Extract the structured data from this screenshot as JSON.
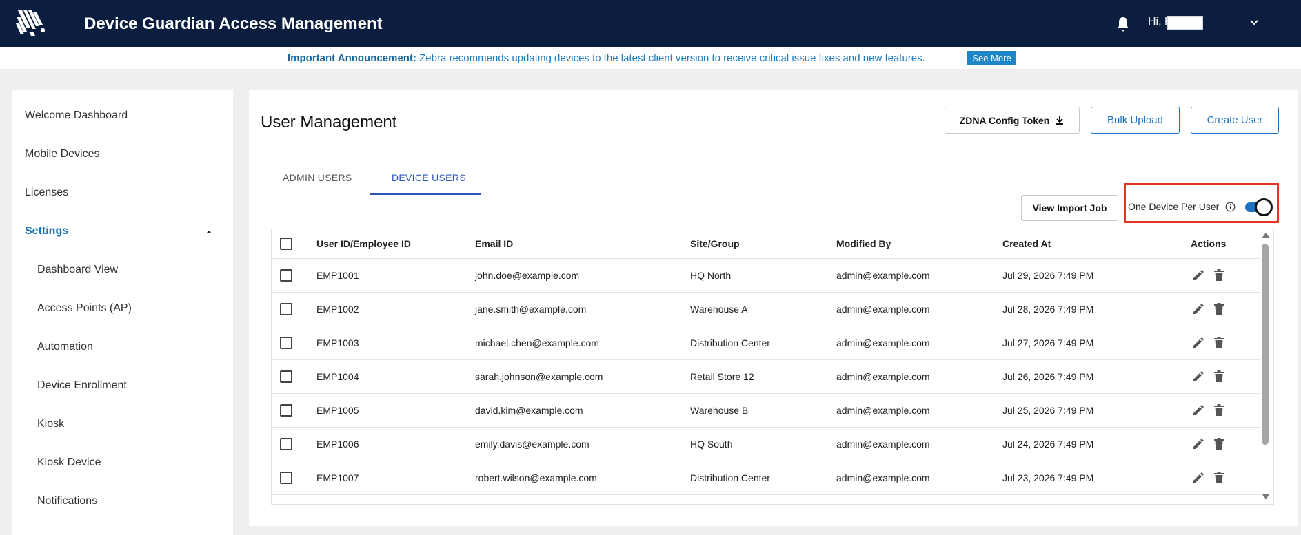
{
  "header": {
    "title": "Device Guardian Access Management",
    "greeting": "Hi, K",
    "brand_color": "#0c1e3f",
    "icons": [
      "zebra-logo",
      "bell-icon",
      "chevron-down-icon"
    ]
  },
  "announcement": {
    "lead": "Important Announcement:",
    "message": "Zebra recommends updating devices to the latest client version to receive critical issue fixes and new features.",
    "link_label": "See More"
  },
  "sidebar": {
    "items": [
      {
        "label": "Welcome Dashboard"
      },
      {
        "label": "Mobile Devices"
      },
      {
        "label": "Licenses"
      },
      {
        "label": "Settings"
      },
      {
        "label": "Dashboard View"
      },
      {
        "label": "Access Points (AP)"
      },
      {
        "label": "Automation"
      },
      {
        "label": "Device Enrollment"
      },
      {
        "label": "Kiosk"
      },
      {
        "label": "Kiosk Device"
      },
      {
        "label": "Notifications"
      }
    ],
    "active": "Settings"
  },
  "main": {
    "title": "User Management",
    "buttons": {
      "zdna": "ZDNA Config Token",
      "bulk_upload": "Bulk Upload",
      "create_user": "Create User",
      "view_import_job": "View Import Job"
    },
    "tabs": [
      {
        "label": "ADMIN USERS",
        "selected": false
      },
      {
        "label": "DEVICE USERS",
        "selected": true
      }
    ],
    "one_device_per_user": {
      "label": "One Device Per User",
      "enabled": true
    },
    "accent_color": "#1a72c0",
    "highlight_color": "#e43224"
  },
  "table": {
    "columns": [
      "User ID/Employee ID",
      "Email ID",
      "Site/Group",
      "Modified By",
      "Created At",
      "Actions"
    ],
    "rows": [
      {
        "uid": "EMP1001",
        "email": "john.doe@example.com",
        "site": "HQ North",
        "modified_by": "admin@example.com",
        "created_at": "Jul 29, 2026 7:49 PM"
      },
      {
        "uid": "EMP1002",
        "email": "jane.smith@example.com",
        "site": "Warehouse A",
        "modified_by": "admin@example.com",
        "created_at": "Jul 28, 2026 7:49 PM"
      },
      {
        "uid": "EMP1003",
        "email": "michael.chen@example.com",
        "site": "Distribution Center",
        "modified_by": "admin@example.com",
        "created_at": "Jul 27, 2026 7:49 PM"
      },
      {
        "uid": "EMP1004",
        "email": "sarah.johnson@example.com",
        "site": "Retail Store 12",
        "modified_by": "admin@example.com",
        "created_at": "Jul 26, 2026 7:49 PM"
      },
      {
        "uid": "EMP1005",
        "email": "david.kim@example.com",
        "site": "Warehouse B",
        "modified_by": "admin@example.com",
        "created_at": "Jul 25, 2026 7:49 PM"
      },
      {
        "uid": "EMP1006",
        "email": "emily.davis@example.com",
        "site": "HQ South",
        "modified_by": "admin@example.com",
        "created_at": "Jul 24, 2026 7:49 PM"
      },
      {
        "uid": "EMP1007",
        "email": "robert.wilson@example.com",
        "site": "Distribution Center",
        "modified_by": "admin@example.com",
        "created_at": "Jul 23, 2026 7:49 PM"
      }
    ],
    "row_action_icons": [
      "edit-icon",
      "delete-icon"
    ]
  }
}
